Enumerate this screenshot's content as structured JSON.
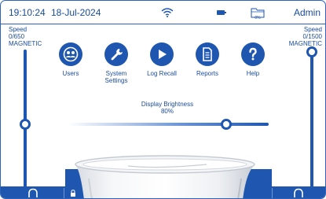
{
  "status_bar": {
    "time": "19:10:24",
    "date": "18-Jul-2024",
    "storage_percent": "0%",
    "user": "Admin"
  },
  "speed_left": {
    "title": "Speed",
    "value": "0/650",
    "mode": "MAGNETIC",
    "level": 0.5
  },
  "speed_right": {
    "title": "Speed",
    "value": "0/1500",
    "mode": "MAGNETIC",
    "level": 1.0
  },
  "menu": [
    {
      "id": "users",
      "label": "Users",
      "icon": "users-icon"
    },
    {
      "id": "system",
      "label": "System Settings",
      "icon": "wrench-icon"
    },
    {
      "id": "log",
      "label": "Log Recall",
      "icon": "play-icon"
    },
    {
      "id": "reports",
      "label": "Reports",
      "icon": "document-icon"
    },
    {
      "id": "help",
      "label": "Help",
      "icon": "question-icon"
    }
  ],
  "menu_labels": {
    "users": "Users",
    "system_line1": "System",
    "system_line2": "Settings",
    "log": "Log Recall",
    "reports": "Reports",
    "help": "Help"
  },
  "brightness": {
    "label": "Display Brightness",
    "value": "80%",
    "level": 0.8
  },
  "colors": {
    "primary": "#1e56b0",
    "text": "#1a4b9c",
    "background": "#ffffff"
  }
}
